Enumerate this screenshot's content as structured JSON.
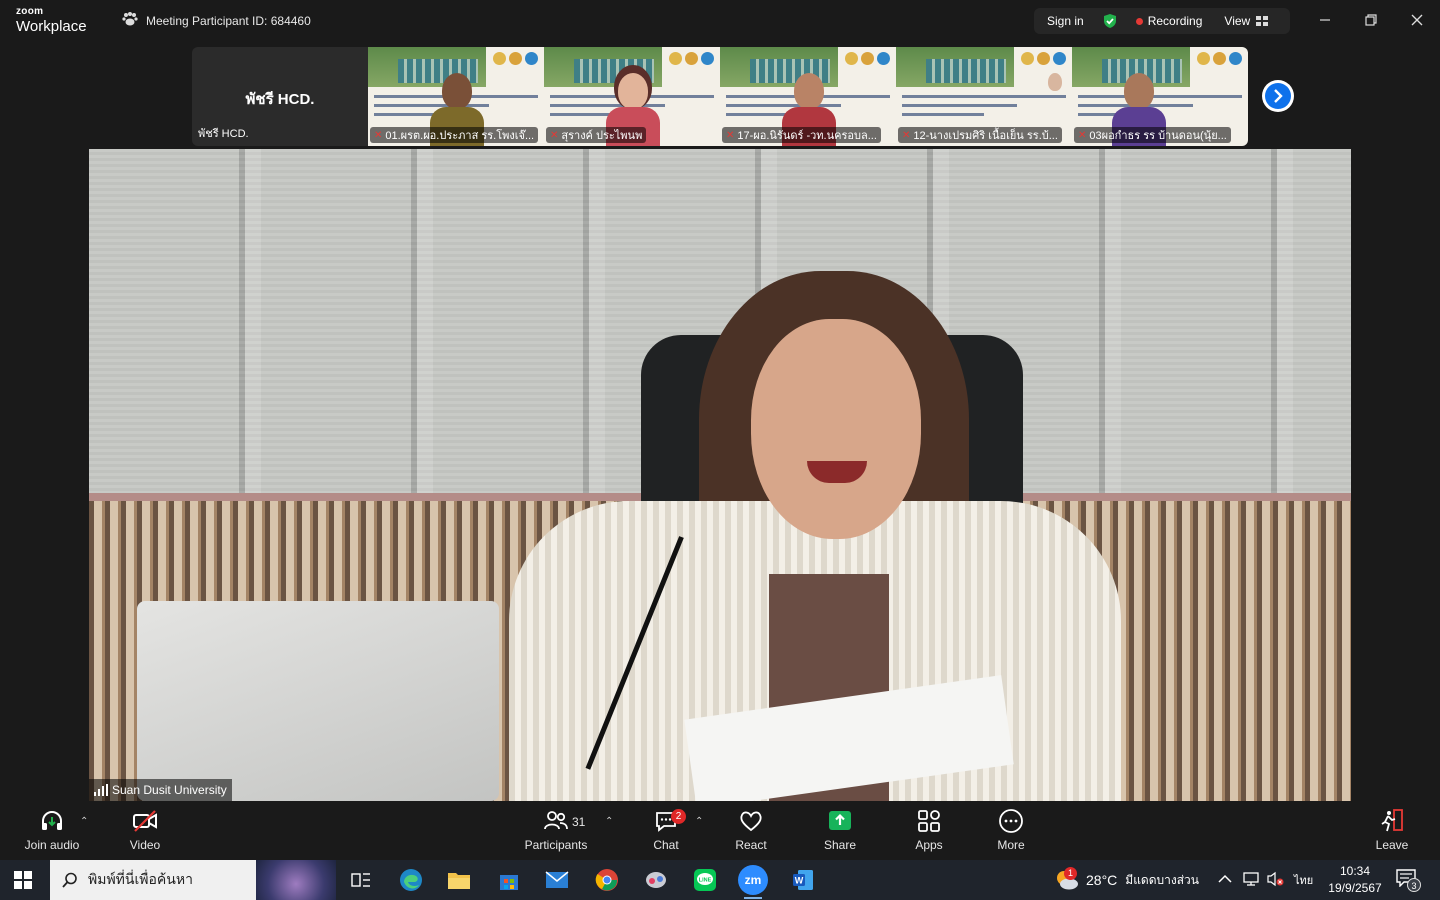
{
  "titlebar": {
    "brand_top": "zoom",
    "brand_bottom": "Workplace",
    "meeting_id": "Meeting Participant ID: 684460",
    "sign_in": "Sign in",
    "recording": "Recording",
    "view": "View"
  },
  "thumbnails": {
    "self_name_big": "พัชรี HCD.",
    "self_name_small": "พัชรี HCD.",
    "tiles": [
      {
        "name": "01.ผรต.ผอ.ประภาส รร.โพงเจ๊..."
      },
      {
        "name": "สุรางค์ ประไพนพ"
      },
      {
        "name": "17-ผอ.นิรันดร์ -วท.นครอบล..."
      },
      {
        "name": "12-นางเปรมศิริ เนื้อเย็น รร.บ้..."
      },
      {
        "name": "03ผอกำธร รร บ้านดอน(นุ้ย..."
      }
    ]
  },
  "main_video": {
    "label": "Suan Dusit University"
  },
  "toolbar": {
    "join_audio": "Join audio",
    "video": "Video",
    "participants": "Participants",
    "participants_count": "31",
    "chat": "Chat",
    "chat_badge": "2",
    "react": "React",
    "share": "Share",
    "apps": "Apps",
    "more": "More",
    "leave": "Leave"
  },
  "taskbar": {
    "search_placeholder": "พิมพ์ที่นี่เพื่อค้นหา",
    "weather_temp": "28°C",
    "weather_text": "มีแดดบางส่วน",
    "weather_badge": "1",
    "language": "ไทย",
    "time": "10:34",
    "date": "19/9/2567",
    "notifications": "3"
  },
  "colors": {
    "accent_blue": "#0e71eb",
    "recording_red": "#e53935",
    "share_green": "#17b35a"
  }
}
